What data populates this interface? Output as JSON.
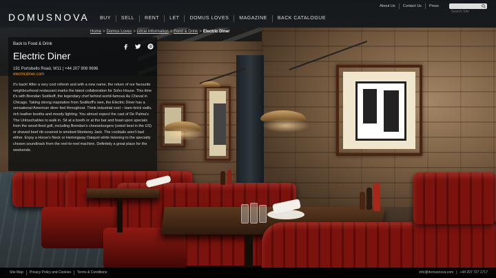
{
  "brand": {
    "logo_text": "DOMUSNOVA"
  },
  "nav": {
    "items": [
      {
        "label": "BUY"
      },
      {
        "label": "SELL"
      },
      {
        "label": "RENT"
      },
      {
        "label": "LET"
      },
      {
        "label": "DOMUS LOVES"
      },
      {
        "label": "MAGAZINE"
      },
      {
        "label": "BACK CATALOGUE"
      }
    ]
  },
  "utility": {
    "items": [
      {
        "label": "About Us"
      },
      {
        "label": "Contact Us"
      },
      {
        "label": "Press"
      }
    ],
    "search_placeholder": "Search Site"
  },
  "breadcrumb": {
    "items": [
      {
        "label": "Home"
      },
      {
        "label": "Domus Loves"
      },
      {
        "label": "Local Information"
      },
      {
        "label": "Food & Drink"
      }
    ],
    "separator": ">",
    "current": "Electric Diner"
  },
  "panel": {
    "back_label": "Back to Food & Drink",
    "social_icons": [
      "facebook-icon",
      "twitter-icon",
      "pinterest-icon"
    ],
    "title": "Electric Diner",
    "address": "191 Portobello Road, W11  |  +44 207 908 9696",
    "website": "electricdiner.com",
    "body": "It's back! After a very cool refresh and with a new name, the return of our favourite neighbourhood restaurant marks the latest collaboration for Soho House. This time it's with Brendan Sodikoff, the legendary chef behind world-famous Au Cheval in Chicago. Taking strong inspiration from Sodikoff's own, the Electric Diner has a sensational American diner feel throughout. Think industrial cool – bare-brick walls, rich leather booths and moody lighting. You almost expect the cast of De Palma's The Untouchables to walk in. Sit at a booth or at the bar and feast upon specials from the wood-fired grill, including Brendan's cheeseburgers (voted best in the US) or shaved beef rib covered in smoked Monterey Jack. The cocktails aren't bad either. Enjoy a Horse's Neck or Hemingway Daiquiri while listening to the specially chosen soundtrack from the reel-to-reel machine. Definitely a great place for the weekends."
  },
  "footer": {
    "links": [
      {
        "label": "Site Map"
      },
      {
        "label": "Privacy Policy and Cookies"
      },
      {
        "label": "Terms & Conditions"
      }
    ],
    "email": "info@domusnova.com",
    "separator": "|",
    "phone": "+44 207 727 1717"
  },
  "colors": {
    "accent": "#ff9c1a",
    "header_bg": "#181c20",
    "booth_red": "#8d1a12"
  }
}
